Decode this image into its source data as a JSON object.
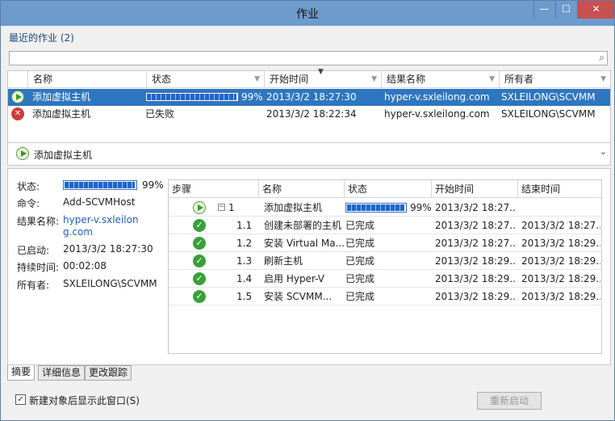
{
  "window": {
    "title": "作业",
    "min": "—",
    "max": "☐",
    "close": "✕"
  },
  "recent": {
    "label": "最近的作业 (2)"
  },
  "search": {
    "icon": "⌕",
    "value": ""
  },
  "jobs_columns": [
    "名称",
    "状态",
    "开始时间",
    "结果名称",
    "所有者"
  ],
  "jobs": [
    {
      "name": "添加虚拟主机",
      "status_icon": "play-icon",
      "status_percent": "99%",
      "progress": 0.99,
      "start": "2013/3/2 18:27:30",
      "result": "hyper-v.sxleilong.com",
      "owner": "SXLEILONG\\SCVMM"
    },
    {
      "name": "添加虚拟主机",
      "status_icon": "fail-icon",
      "status_text": "已失败",
      "start": "2013/3/2 18:22:34",
      "result": "hyper-v.sxleilong.com",
      "owner": "SXLEILONG\\SCVMM"
    }
  ],
  "detail": {
    "title": "添加虚拟主机",
    "chevron": "⌄",
    "labels": {
      "status": "状态:",
      "command": "命令:",
      "result": "结果名称:",
      "started": "已启动:",
      "duration": "持续时间:",
      "owner": "所有者:"
    },
    "values": {
      "status_percent": "99%",
      "progress": 0.99,
      "command": "Add-SCVMHost",
      "result": "hyper-v.sxleilong.com",
      "started": "2013/3/2 18:27:30",
      "duration": "00:02:08",
      "owner": "SXLEILONG\\SCVMM"
    }
  },
  "steps_columns": [
    "步骤",
    "名称",
    "状态",
    "开始时间",
    "结束时间"
  ],
  "steps": [
    {
      "step": "1",
      "name": "添加虚拟主机",
      "status": "99%",
      "progress": 0.99,
      "start": "2013/3/2 18:27...",
      "end": "",
      "icon": "play-icon",
      "expander": "⊟"
    },
    {
      "step": "1.1",
      "name": "创建未部署的主机",
      "status": "已完成",
      "start": "2013/3/2 18:27...",
      "end": "2013/3/2 18:27...",
      "icon": "check-icon"
    },
    {
      "step": "1.2",
      "name": "安装 Virtual Ma...",
      "status": "已完成",
      "start": "2013/3/2 18:27...",
      "end": "2013/3/2 18:29...",
      "icon": "check-icon"
    },
    {
      "step": "1.3",
      "name": "刷新主机",
      "status": "已完成",
      "start": "2013/3/2 18:29...",
      "end": "2013/3/2 18:29...",
      "icon": "check-icon"
    },
    {
      "step": "1.4",
      "name": "启用 Hyper-V",
      "status": "已完成",
      "start": "2013/3/2 18:29...",
      "end": "2013/3/2 18:29...",
      "icon": "check-icon"
    },
    {
      "step": "1.5",
      "name": "安装 SCVMM...",
      "status": "已完成",
      "start": "2013/3/2 18:29...",
      "end": "2013/3/2 18:29...",
      "icon": "check-icon"
    }
  ],
  "tabs": [
    "摘要",
    "详细信息",
    "更改跟踪"
  ],
  "footer": {
    "checkbox_checked": "✓",
    "checkbox_label": "新建对象后显示此窗口(S)",
    "restart_button": "重新启动"
  },
  "colors": {
    "titlebar": "#6d9bcb",
    "selection": "#2e76c0",
    "link": "#1f5fb5",
    "success": "#3aa03a",
    "error": "#d23a3a"
  }
}
